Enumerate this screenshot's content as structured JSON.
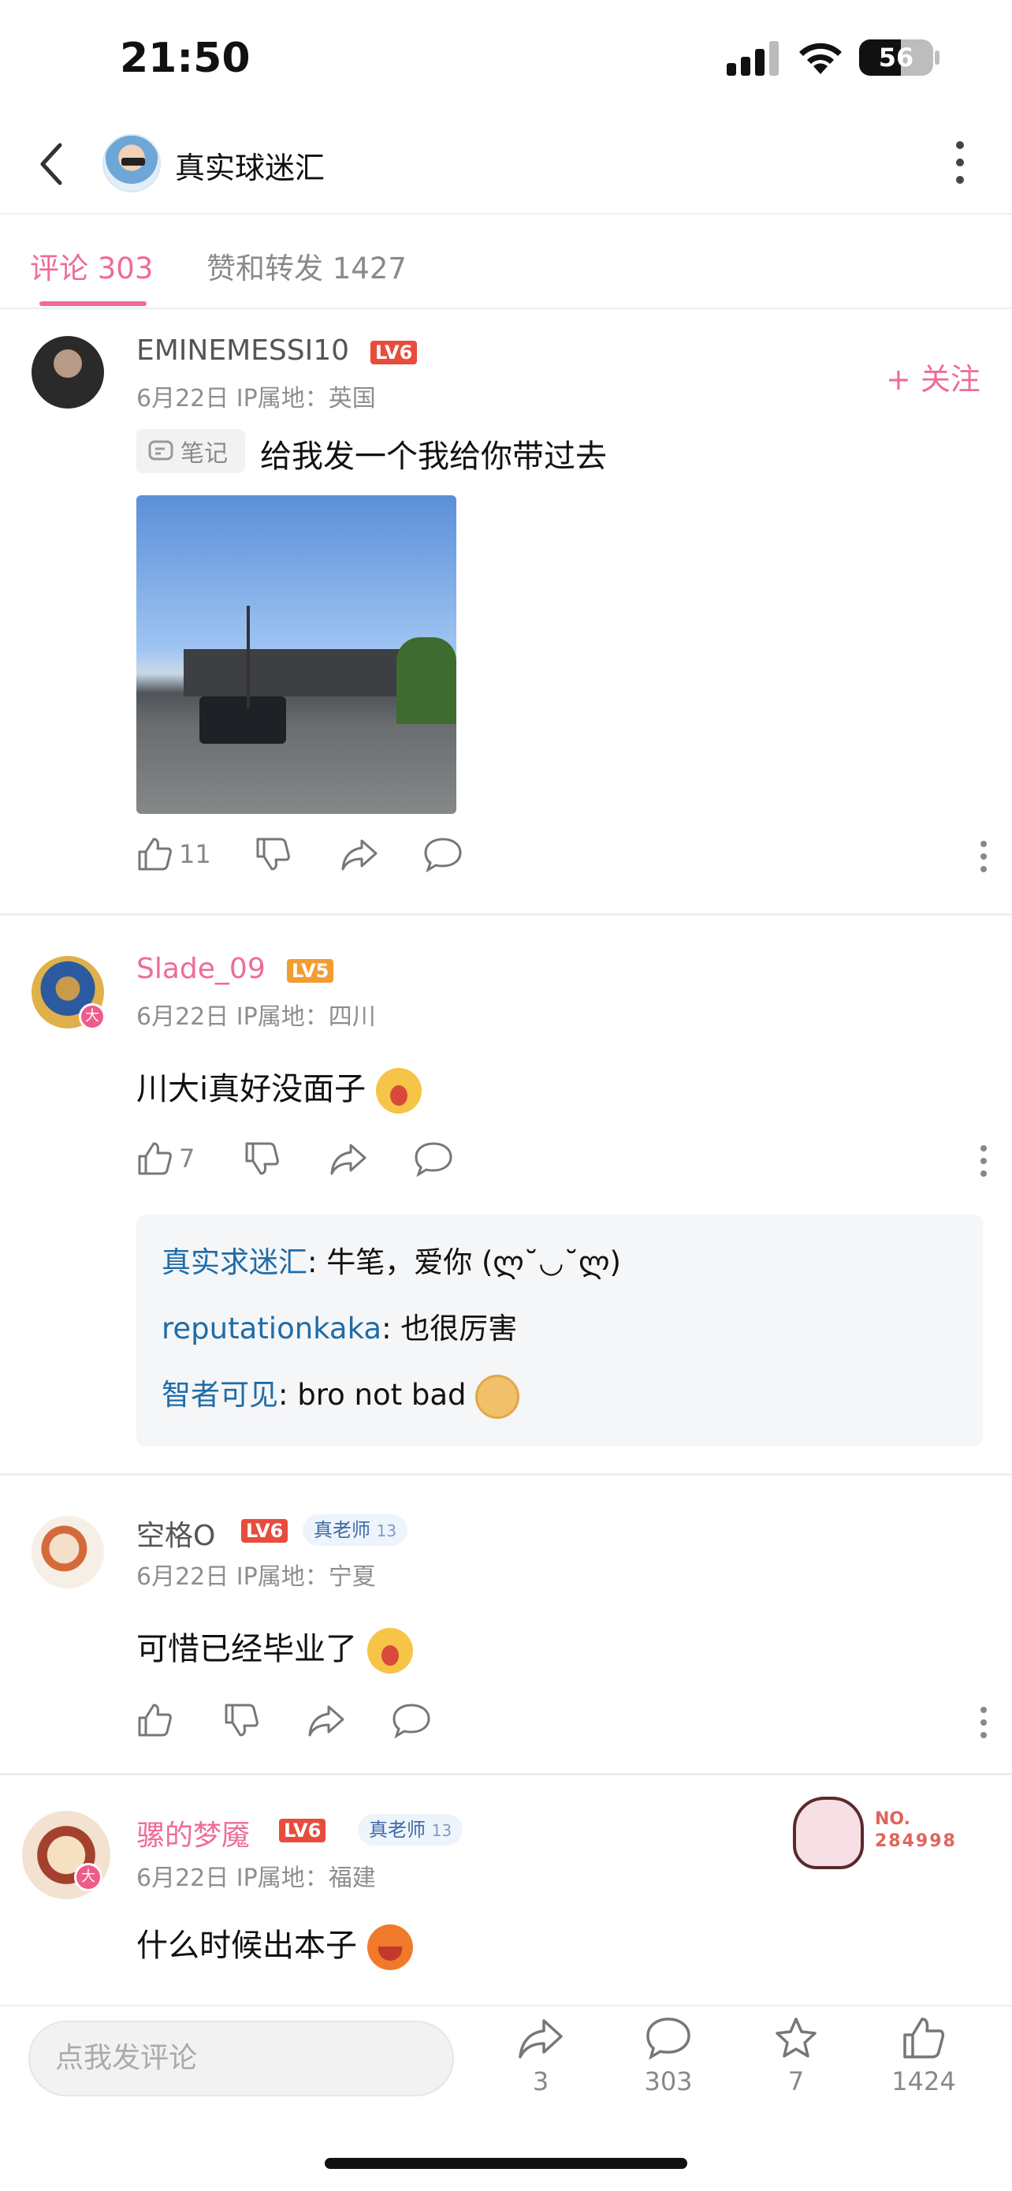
{
  "status": {
    "time": "21:50",
    "battery": "56"
  },
  "header": {
    "title": "真实球迷汇"
  },
  "tabs": [
    {
      "label": "评论 303",
      "active": true
    },
    {
      "label": "赞和转发 1427",
      "active": false
    }
  ],
  "comments": [
    {
      "username": "EMINEMESSI10",
      "level": "LV6",
      "meta": "6月22日  IP属地：英国",
      "follow": "+ 关注",
      "note_tag": "笔记",
      "text": "给我发一个我给你带过去",
      "likes": "11"
    },
    {
      "username": "Slade_09",
      "level": "LV5",
      "avatar_badge": "大",
      "meta": "6月22日  IP属地：四川",
      "text": "川大i真好没面子",
      "likes": "7",
      "replies": [
        {
          "who": "真实求迷汇",
          "text": ": 牛笔，爱你 (ლ˘◡˘ლ)"
        },
        {
          "who": "reputationkaka",
          "text": ": 也很厉害"
        },
        {
          "who": "智者可见",
          "text": ": bro not bad"
        }
      ]
    },
    {
      "username": "空格O",
      "level": "LV6",
      "badge": "真老师",
      "badge_num": "13",
      "meta": "6月22日  IP属地：宁夏",
      "text": "可惜已经毕业了"
    },
    {
      "username": "骡的梦魇",
      "level": "LV6",
      "avatar_badge": "大",
      "badge": "真老师",
      "badge_num": "13",
      "meta": "6月22日  IP属地：福建",
      "text": "什么时候出本子",
      "no_label": "NO.",
      "no_value": "284998"
    }
  ],
  "bottom": {
    "input_placeholder": "点我发评论",
    "share": "3",
    "comment": "303",
    "star": "7",
    "like": "1424"
  },
  "colors": {
    "accent": "#ef6b9a",
    "reply_name": "#1f6ca8",
    "level_red": "#e84c3d",
    "level_orange": "#f39c32"
  }
}
